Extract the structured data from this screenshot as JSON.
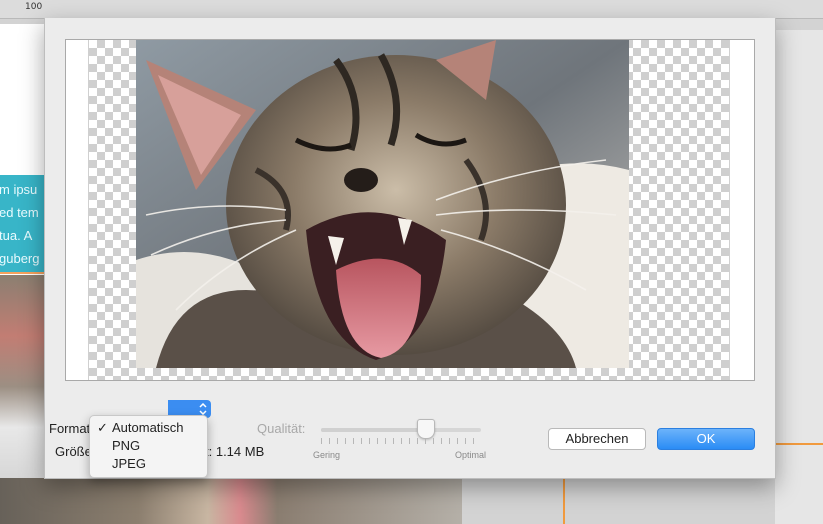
{
  "background": {
    "ruler_number": "100",
    "text_fragments": [
      "m ipsu",
      "ed tem",
      "tua. A",
      "guberg"
    ]
  },
  "dialog": {
    "format_label": "Format",
    "size_label": "Größe",
    "size_value_suffix": "t: 1.14 MB",
    "quality_label": "Qualität:",
    "slider": {
      "value": 0.65,
      "min_label": "Gering",
      "max_label": "Optimal"
    },
    "cancel_label": "Abbrechen",
    "ok_label": "OK"
  },
  "format_menu": {
    "selected_index": 0,
    "options": [
      "Automatisch",
      "PNG",
      "JPEG"
    ],
    "check_mark": "✓"
  },
  "colors": {
    "accent": "#3b8df1",
    "ok_button": "#2a8cf5",
    "guide_orange": "#f19a3e",
    "teal": "#38b5c8"
  },
  "icons": {
    "popup_chevron": "chevron-updown-icon"
  }
}
